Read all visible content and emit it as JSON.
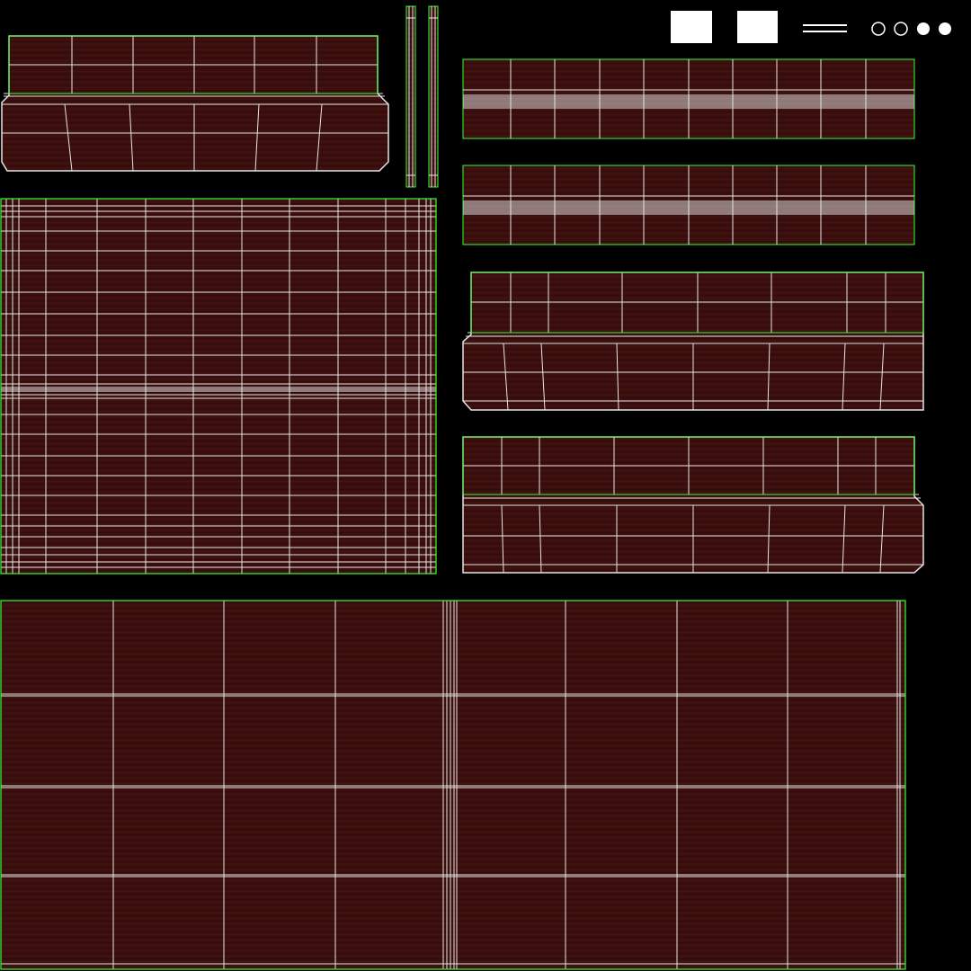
{
  "colors": {
    "background": "#000000",
    "wood": "#3a0f0d",
    "wood_dark": "#2c0a09",
    "grain": "#4a1714",
    "wire": "#e6e6e6",
    "outline": "#37ff37"
  },
  "islands": [
    {
      "name": "uv-island-upper-left-molding",
      "kind": "molding"
    },
    {
      "name": "uv-island-thin-strip-a",
      "kind": "strip"
    },
    {
      "name": "uv-island-thin-strip-b",
      "kind": "strip"
    },
    {
      "name": "uv-island-top-panel",
      "kind": "panel"
    },
    {
      "name": "uv-island-right-board-1",
      "kind": "board"
    },
    {
      "name": "uv-island-right-board-2",
      "kind": "board"
    },
    {
      "name": "uv-island-right-molding-1",
      "kind": "molding"
    },
    {
      "name": "uv-island-right-molding-2",
      "kind": "molding"
    },
    {
      "name": "uv-island-large-bottom-panel",
      "kind": "panel"
    }
  ],
  "small_pieces": [
    "white-square",
    "white-square",
    "double-line",
    "ring",
    "ring",
    "disc",
    "disc"
  ]
}
